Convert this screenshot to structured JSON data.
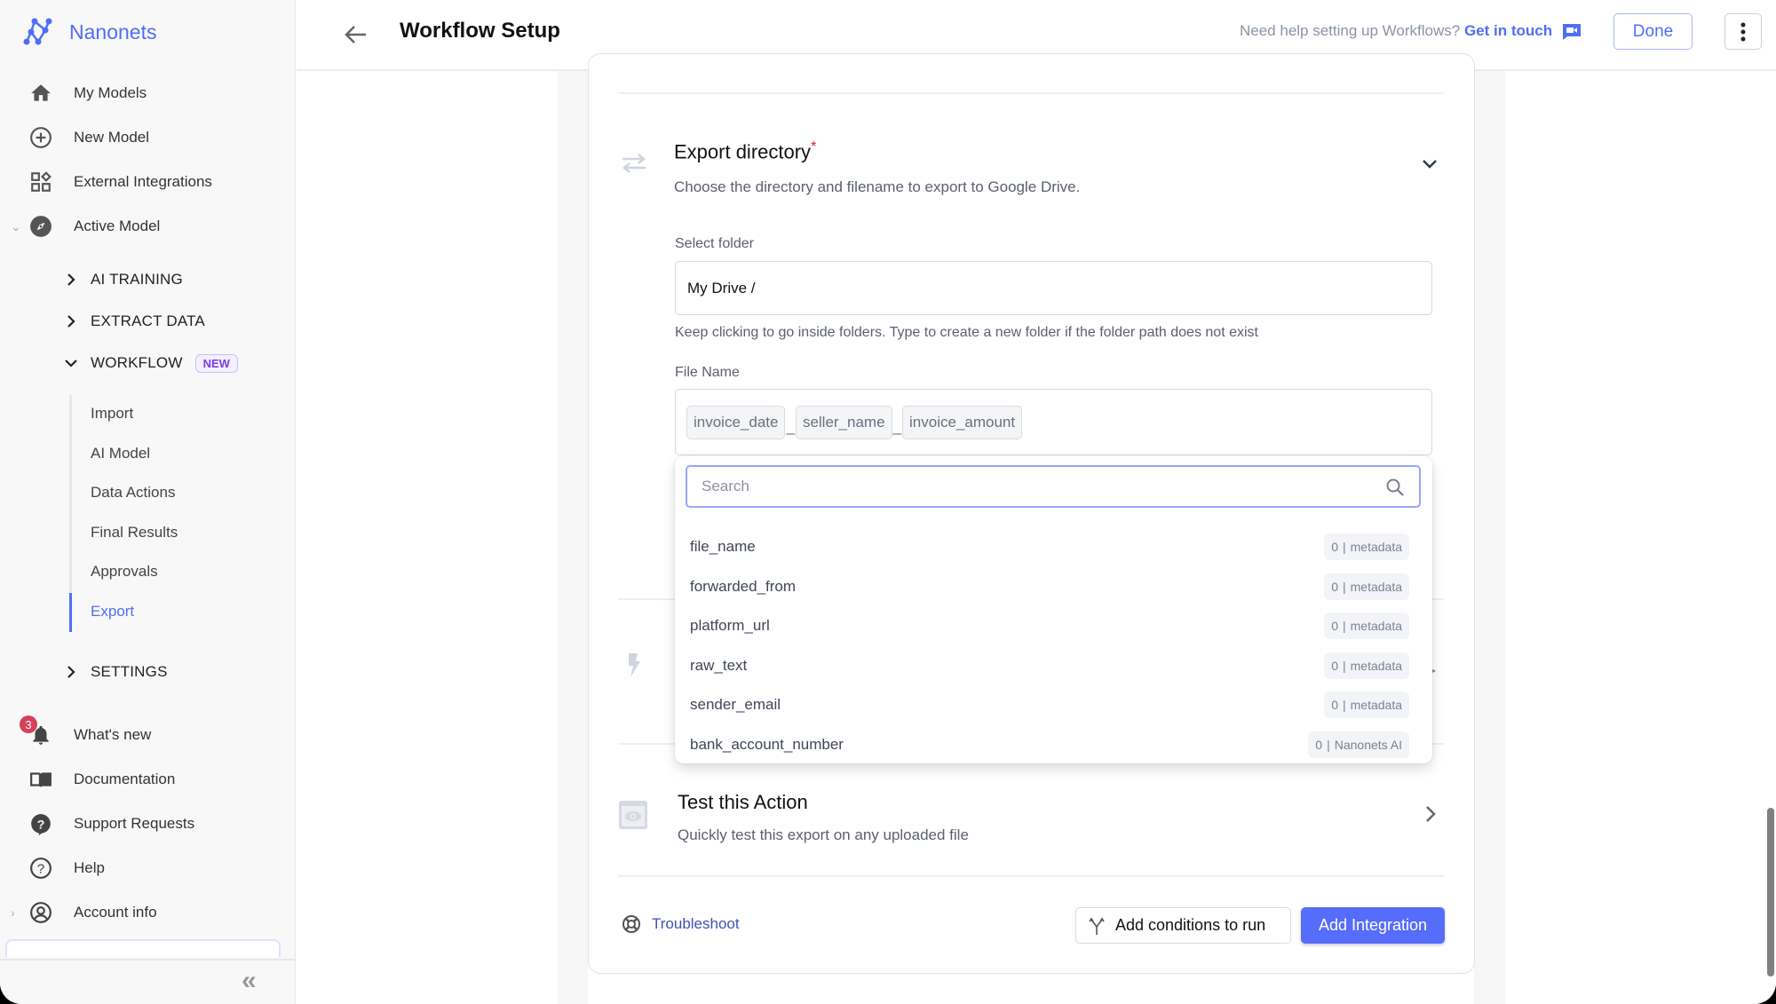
{
  "app": {
    "brand": "Nanonets",
    "brand_color": "#4f6ef7"
  },
  "sidebar": {
    "main_items": [
      {
        "label": "My Models",
        "icon": "home-icon"
      },
      {
        "label": "New Model",
        "icon": "plus-circle-icon"
      },
      {
        "label": "External Integrations",
        "icon": "widgets-icon"
      },
      {
        "label": "Active Model",
        "icon": "compass-icon"
      }
    ],
    "sections": [
      {
        "label": "AI TRAINING",
        "expanded": false
      },
      {
        "label": "EXTRACT DATA",
        "expanded": false
      },
      {
        "label": "WORKFLOW",
        "expanded": true,
        "badge": "NEW"
      },
      {
        "label": "SETTINGS",
        "expanded": false
      }
    ],
    "workflow_items": [
      {
        "label": "Import",
        "active": false
      },
      {
        "label": "AI Model",
        "active": false
      },
      {
        "label": "Data Actions",
        "active": false
      },
      {
        "label": "Final Results",
        "active": false
      },
      {
        "label": "Approvals",
        "active": false
      },
      {
        "label": "Export",
        "active": true
      }
    ],
    "bottom_items": [
      {
        "label": "What's new",
        "icon": "bell-icon",
        "badge": "3"
      },
      {
        "label": "Documentation",
        "icon": "book-icon"
      },
      {
        "label": "Support Requests",
        "icon": "support-icon"
      },
      {
        "label": "Help",
        "icon": "help-circle-icon"
      },
      {
        "label": "Account info",
        "icon": "account-icon"
      }
    ],
    "collapse_glyph": "«"
  },
  "header": {
    "title": "Workflow Setup",
    "help_text": "Need help setting up Workflows?",
    "help_link": "Get in touch",
    "done_label": "Done"
  },
  "export_directory": {
    "title": "Export directory",
    "required_mark": "*",
    "description": "Choose the directory and filename to export to Google Drive.",
    "folder_label": "Select folder",
    "folder_value": "My Drive /",
    "folder_hint": "Keep clicking to go inside folders. Type to create a new folder if the folder path does not exist",
    "filename_label": "File Name",
    "filename_chips": [
      "invoice_date",
      "seller_name",
      "invoice_amount"
    ],
    "chip_separator": "_"
  },
  "dropdown": {
    "search_placeholder": "Search",
    "items": [
      {
        "name": "file_name",
        "count": "0",
        "source": "metadata"
      },
      {
        "name": "forwarded_from",
        "count": "0",
        "source": "metadata"
      },
      {
        "name": "platform_url",
        "count": "0",
        "source": "metadata"
      },
      {
        "name": "raw_text",
        "count": "0",
        "source": "metadata"
      },
      {
        "name": "sender_email",
        "count": "0",
        "source": "metadata"
      },
      {
        "name": "bank_account_number",
        "count": "0",
        "source": "Nanonets AI"
      }
    ]
  },
  "test_action": {
    "title": "Test this Action",
    "description": "Quickly test this export on any uploaded file"
  },
  "footer": {
    "troubleshoot": "Troubleshoot",
    "conditions_button": "Add conditions to run",
    "add_integration_button": "Add Integration"
  }
}
